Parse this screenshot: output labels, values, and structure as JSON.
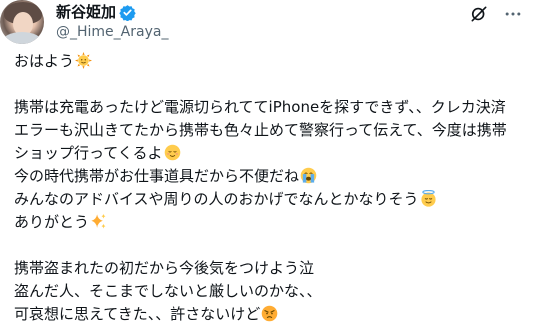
{
  "author": {
    "display_name": "新谷姫加",
    "handle": "@_Hime_Araya_",
    "avatar_icon": "profile-photo",
    "verified_icon": "verified-badge-icon"
  },
  "header_actions": [
    {
      "icon": "grok-icon"
    },
    {
      "icon": "more-options-icon"
    }
  ],
  "post": {
    "lines": [
      {
        "text": "おはよう",
        "emoji": "sun-with-face-icon"
      },
      {
        "text": "",
        "emoji": ""
      },
      {
        "text": "携帯は充電あったけど電源切られててiPhoneを探すできず、、クレカ決済",
        "emoji": ""
      },
      {
        "text": "エラーも沢山きてたから携帯も色々止めて警察行って伝えて、今度は携帯",
        "emoji": ""
      },
      {
        "text": "ショップ行ってくるよ",
        "emoji": "relieved-face-icon"
      },
      {
        "text": "今の時代携帯がお仕事道具だから不便だね",
        "emoji": "crying-face-icon"
      },
      {
        "text": "みんなのアドバイスや周りの人のおかげでなんとかなりそう",
        "emoji": "halo-face-icon"
      },
      {
        "text": "ありがとう",
        "emoji": "sparkles-icon"
      },
      {
        "text": "",
        "emoji": ""
      },
      {
        "text": "携帯盗まれたの初だから今後気をつけよう泣",
        "emoji": ""
      },
      {
        "text": "盗んだ人、そこまでしないと厳しいのかな、、",
        "emoji": ""
      },
      {
        "text": "可哀想に思えてきた、、許さないけど",
        "emoji": "angry-face-icon"
      }
    ]
  },
  "colors": {
    "text": "#0f1419",
    "secondary_text": "#536471",
    "verified_blue": "#1d9bf0",
    "emoji_yellow": "#ffcc4d",
    "emoji_orange": "#f4900c"
  }
}
